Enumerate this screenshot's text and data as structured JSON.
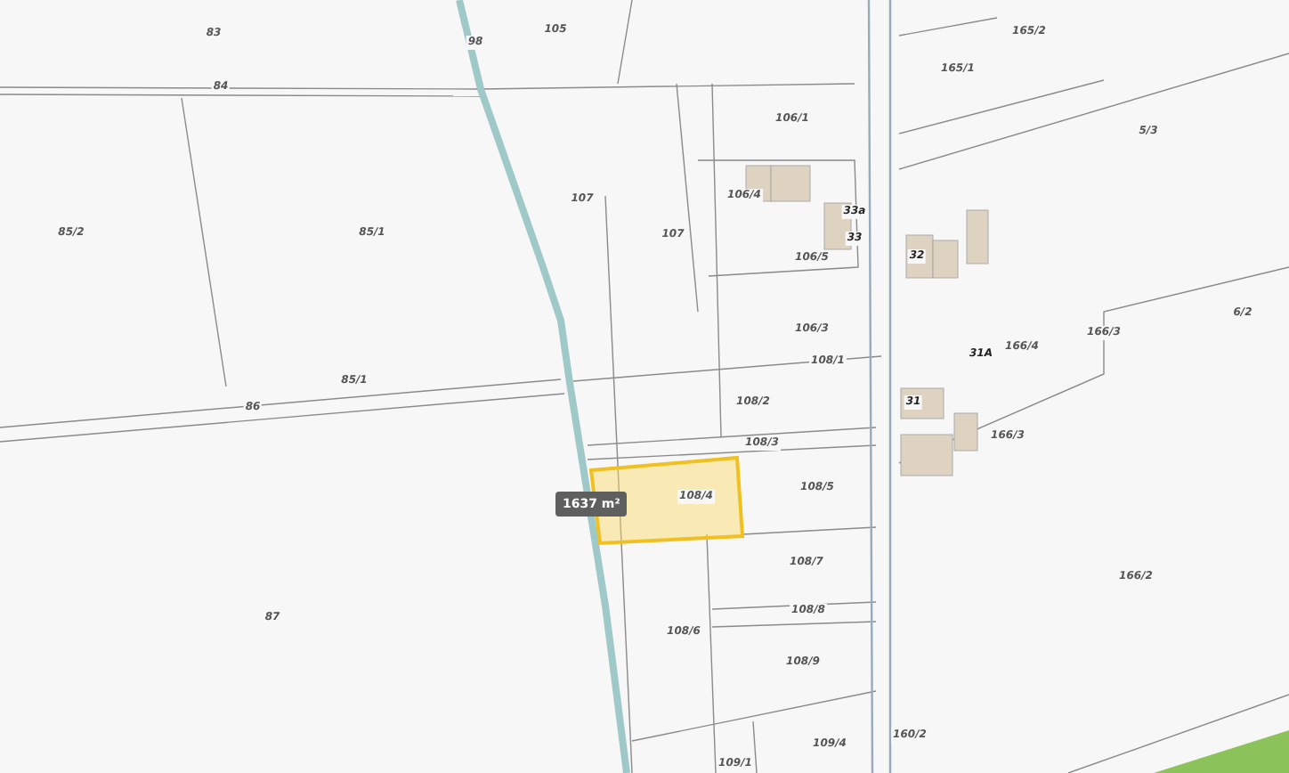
{
  "map": {
    "parcel_labels": [
      {
        "text": "83"
      },
      {
        "text": "84"
      },
      {
        "text": "98"
      },
      {
        "text": "105"
      },
      {
        "text": "85/2"
      },
      {
        "text": "85/1"
      },
      {
        "text": "107"
      },
      {
        "text": "85/1"
      },
      {
        "text": "86"
      },
      {
        "text": "87"
      },
      {
        "text": "107"
      },
      {
        "text": "106/1"
      },
      {
        "text": "106/4"
      },
      {
        "text": "33a"
      },
      {
        "text": "33"
      },
      {
        "text": "106/5"
      },
      {
        "text": "32"
      },
      {
        "text": "106/3"
      },
      {
        "text": "108/1"
      },
      {
        "text": "165/2"
      },
      {
        "text": "165/1"
      },
      {
        "text": "5/3"
      },
      {
        "text": "166/4"
      },
      {
        "text": "31A"
      },
      {
        "text": "166/3"
      },
      {
        "text": "6/2"
      },
      {
        "text": "31"
      },
      {
        "text": "166/3"
      },
      {
        "text": "108/2"
      },
      {
        "text": "108/3"
      },
      {
        "text": "108/4"
      },
      {
        "text": "108/5"
      },
      {
        "text": "108/7"
      },
      {
        "text": "108/8"
      },
      {
        "text": "108/6"
      },
      {
        "text": "108/9"
      },
      {
        "text": "166/2"
      },
      {
        "text": "160/2"
      },
      {
        "text": "109/4"
      },
      {
        "text": "109/1"
      }
    ],
    "area_badge": {
      "text": "1637 m²"
    },
    "selected_parcel": {
      "selected": true
    }
  }
}
